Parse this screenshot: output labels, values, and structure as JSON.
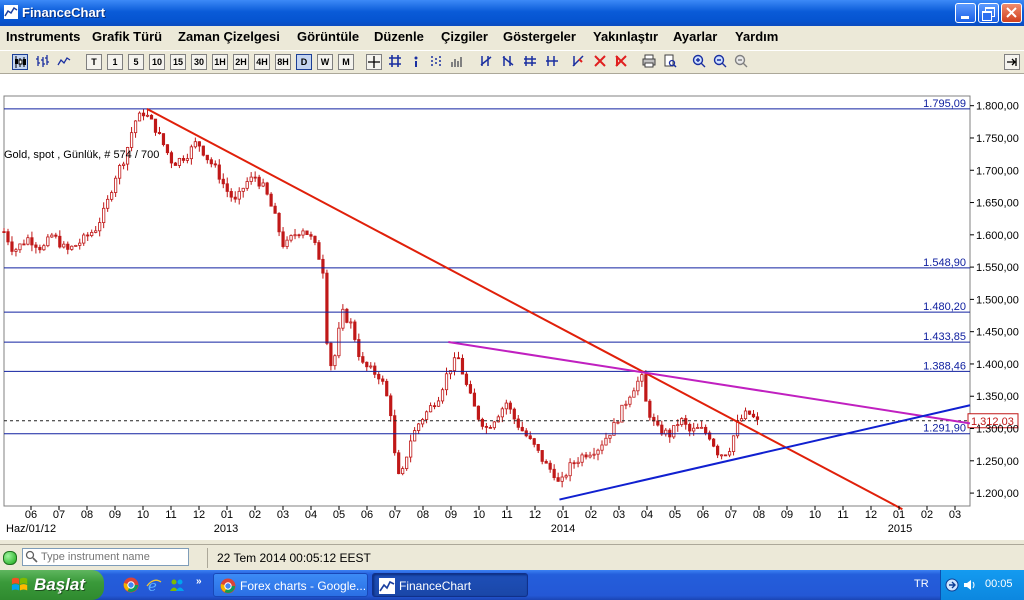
{
  "window": {
    "title": "FinanceChart"
  },
  "menu": [
    "Instruments",
    "Grafik Türü",
    "Zaman Çizelgesi",
    "Görüntüle",
    "Düzenle",
    "Çizgiler",
    "Göstergeler",
    "Yakınlaştır",
    "Ayarlar",
    "Yardım"
  ],
  "toolbar": {
    "timeframes": [
      "T",
      "1",
      "5",
      "10",
      "15",
      "30",
      "1H",
      "2H",
      "4H",
      "8H",
      "D",
      "W",
      "M"
    ],
    "active_timeframe": "D"
  },
  "chart_info": "Gold, spot , Günlük, # 574 / 700",
  "status": {
    "search_placeholder": "Type instrument name",
    "datetime": "22 Tem 2014 00:05:12 EEST"
  },
  "taskbar": {
    "start_label": "Başlat",
    "tasks": [
      "Forex charts - Google...",
      "FinanceChart"
    ],
    "lang": "TR",
    "clock": "00:05"
  },
  "colors": {
    "trend_down": "#e0200a",
    "trend_support": "#1020d0",
    "trend_resistance": "#c020c0",
    "hline": "#1020a0",
    "candle": "#c01818",
    "current_price": "#c01818"
  },
  "chart_data": {
    "type": "candlestick",
    "instrument": "Gold, spot",
    "ylim": [
      1180,
      1815
    ],
    "yticks": [
      "1.200,00",
      "1.250,00",
      "1.300,00",
      "1.350,00",
      "1.400,00",
      "1.450,00",
      "1.500,00",
      "1.550,00",
      "1.600,00",
      "1.650,00",
      "1.700,00",
      "1.750,00",
      "1.800,00"
    ],
    "xticks": [
      "06",
      "07",
      "08",
      "09",
      "10",
      "11",
      "12",
      "01",
      "02",
      "03",
      "04",
      "05",
      "06",
      "07",
      "08",
      "09",
      "10",
      "11",
      "12",
      "01",
      "02",
      "03",
      "04",
      "05",
      "06",
      "07",
      "08",
      "09",
      "10",
      "11",
      "12",
      "01",
      "02",
      "03"
    ],
    "x_sublabels": [
      "Haz/01/12",
      "2013",
      "2014",
      "2015"
    ],
    "horizontal_levels": [
      {
        "label": "1.795,09",
        "value": 1795.09
      },
      {
        "label": "1.548,90",
        "value": 1548.9
      },
      {
        "label": "1.480,20",
        "value": 1480.2
      },
      {
        "label": "1.433,85",
        "value": 1433.85
      },
      {
        "label": "1.388,46",
        "value": 1388.46
      },
      {
        "label": "1.291,90",
        "value": 1291.9
      }
    ],
    "current_price": {
      "label": "1.312,03",
      "value": 1312.03
    },
    "trendlines": [
      {
        "name": "down",
        "from": [
          0.0,
          1795
        ],
        "to": [
          1.0,
          1175
        ]
      },
      {
        "name": "resistance",
        "from": [
          0.0,
          1434
        ],
        "to": [
          1.0,
          1308
        ]
      },
      {
        "name": "support",
        "from": [
          0.0,
          1190
        ],
        "to": [
          1.0,
          1336
        ]
      }
    ],
    "close_path": [
      [
        0.0,
        1605
      ],
      [
        0.01,
        1575
      ],
      [
        0.025,
        1595
      ],
      [
        0.04,
        1578
      ],
      [
        0.05,
        1600
      ],
      [
        0.065,
        1575
      ],
      [
        0.08,
        1590
      ],
      [
        0.095,
        1610
      ],
      [
        0.105,
        1640
      ],
      [
        0.115,
        1690
      ],
      [
        0.125,
        1720
      ],
      [
        0.135,
        1775
      ],
      [
        0.145,
        1790
      ],
      [
        0.155,
        1770
      ],
      [
        0.165,
        1740
      ],
      [
        0.175,
        1710
      ],
      [
        0.19,
        1725
      ],
      [
        0.2,
        1745
      ],
      [
        0.21,
        1720
      ],
      [
        0.22,
        1700
      ],
      [
        0.23,
        1670
      ],
      [
        0.24,
        1650
      ],
      [
        0.25,
        1680
      ],
      [
        0.26,
        1690
      ],
      [
        0.27,
        1670
      ],
      [
        0.28,
        1630
      ],
      [
        0.29,
        1580
      ],
      [
        0.3,
        1600
      ],
      [
        0.31,
        1610
      ],
      [
        0.32,
        1590
      ],
      [
        0.33,
        1550
      ],
      [
        0.335,
        1420
      ],
      [
        0.34,
        1390
      ],
      [
        0.35,
        1480
      ],
      [
        0.36,
        1460
      ],
      [
        0.37,
        1400
      ],
      [
        0.38,
        1390
      ],
      [
        0.39,
        1380
      ],
      [
        0.4,
        1330
      ],
      [
        0.405,
        1250
      ],
      [
        0.41,
        1215
      ],
      [
        0.42,
        1280
      ],
      [
        0.43,
        1310
      ],
      [
        0.44,
        1330
      ],
      [
        0.45,
        1350
      ],
      [
        0.46,
        1390
      ],
      [
        0.47,
        1410
      ],
      [
        0.48,
        1360
      ],
      [
        0.49,
        1320
      ],
      [
        0.5,
        1300
      ],
      [
        0.51,
        1320
      ],
      [
        0.52,
        1340
      ],
      [
        0.53,
        1310
      ],
      [
        0.54,
        1290
      ],
      [
        0.55,
        1270
      ],
      [
        0.56,
        1245
      ],
      [
        0.57,
        1230
      ],
      [
        0.575,
        1210
      ],
      [
        0.585,
        1240
      ],
      [
        0.6,
        1260
      ],
      [
        0.615,
        1270
      ],
      [
        0.63,
        1300
      ],
      [
        0.64,
        1330
      ],
      [
        0.65,
        1360
      ],
      [
        0.66,
        1380
      ],
      [
        0.665,
        1335
      ],
      [
        0.675,
        1300
      ],
      [
        0.69,
        1290
      ],
      [
        0.7,
        1315
      ],
      [
        0.71,
        1295
      ],
      [
        0.72,
        1300
      ],
      [
        0.73,
        1290
      ],
      [
        0.74,
        1260
      ],
      [
        0.75,
        1265
      ],
      [
        0.76,
        1310
      ],
      [
        0.77,
        1325
      ],
      [
        0.78,
        1310
      ]
    ]
  }
}
